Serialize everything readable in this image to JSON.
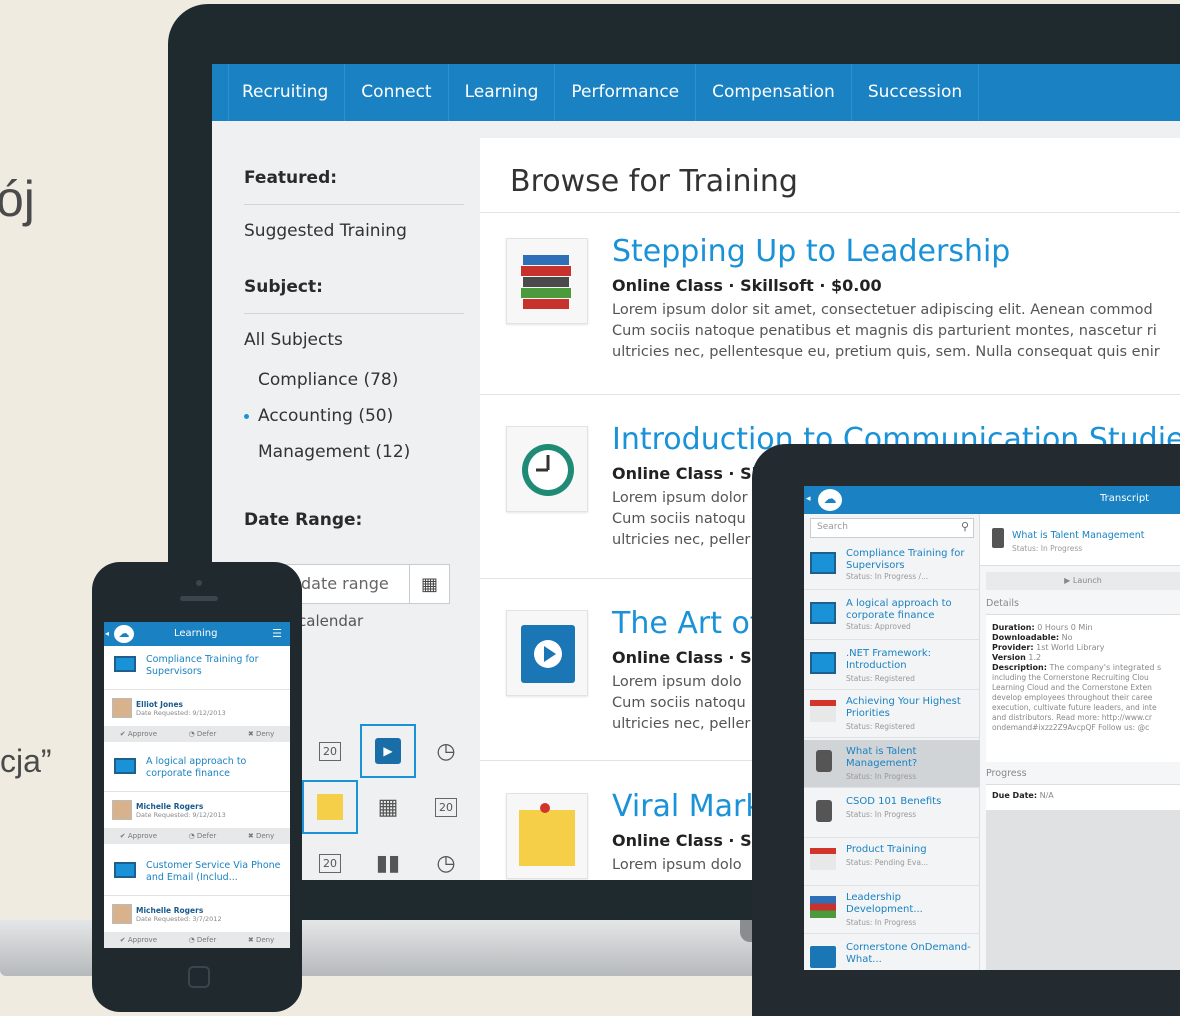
{
  "background": {
    "fragment_1": "ój",
    "fragment_2": "cja”"
  },
  "laptop": {
    "nav": [
      "Recruiting",
      "Connect",
      "Learning",
      "Performance",
      "Compensation",
      "Succession"
    ],
    "sidebar": {
      "featured_heading": "Featured:",
      "suggested": "Suggested Training",
      "subject_heading": "Subject:",
      "all_subjects": "All Subjects",
      "subjects": [
        {
          "label": "Compliance (78)",
          "selected": false
        },
        {
          "label": "Accounting (50)",
          "selected": true
        },
        {
          "label": "Management (12)",
          "selected": false
        }
      ],
      "date_range_heading": "Date Range:",
      "date_placeholder": "date range",
      "calendar_label": "calendar",
      "grid_day": "20"
    },
    "main": {
      "title": "Browse for Training",
      "courses": [
        {
          "title": "Stepping Up to Leadership",
          "meta": "Online Class · Skillsoft · $0.00",
          "desc": [
            "Lorem ipsum dolor sit amet, consectetuer adipiscing elit. Aenean commod",
            "Cum sociis natoque penatibus et magnis dis parturient montes, nascetur ri",
            "ultricies nec, pellentesque eu, pretium quis, sem. Nulla consequat quis enir"
          ]
        },
        {
          "title": "Introduction to Communication Studies",
          "meta": "Online Class · Sk",
          "desc": [
            "Lorem ipsum dolor",
            "Cum sociis natoqu",
            "ultricies nec, peller"
          ]
        },
        {
          "title": "The Art of",
          "meta": "Online Class · Sk",
          "desc": [
            "Lorem ipsum dolo",
            "Cum sociis natoqu",
            "ultricies nec, peller"
          ]
        },
        {
          "title": "Viral Mark",
          "meta": "Online Class · Sk",
          "desc": [
            "Lorem ipsum dolo"
          ]
        }
      ]
    }
  },
  "tablet": {
    "header_title": "Transcript",
    "search_placeholder": "Search",
    "items": [
      {
        "title": "Compliance Training for Supervisors",
        "status": "Status: In Progress /..."
      },
      {
        "title": "A logical approach to corporate finance",
        "status": "Status: Approved"
      },
      {
        "title": ".NET Framework: Introduction",
        "status": "Status: Registered"
      },
      {
        "title": "Achieving Your Highest Priorities",
        "status": "Status: Registered"
      },
      {
        "title": "What is Talent Management?",
        "status": "Status: In Progress"
      },
      {
        "title": "CSOD 101 Benefits",
        "status": "Status: In Progress"
      },
      {
        "title": "Product Training",
        "status": "Status: Pending Eva..."
      },
      {
        "title": "Leadership Development...",
        "status": "Status: In Progress"
      },
      {
        "title": "Cornerstone OnDemand-What...",
        "status": ""
      }
    ],
    "detail": {
      "title": "What is Talent Management",
      "status": "Status: In Progress",
      "launch": "Launch",
      "details_heading": "Details",
      "duration_label": "Duration:",
      "duration": "0 Hours 0 Min",
      "downloadable_label": "Downloadable:",
      "downloadable": "No",
      "provider_label": "Provider:",
      "provider": "1st World Library",
      "version_label": "Version",
      "version": "1.2",
      "description_label": "Description:",
      "description": [
        "The company's integrated s",
        "including the Cornerstone Recruiting Clou",
        "Learning Cloud and the Cornerstone Exten",
        "develop employees throughout their caree",
        "execution, cultivate future leaders, and inte",
        "and distributors. Read more: http://www.cr",
        "ondemand#ixzz2Z9AvcpQF Follow us: @c"
      ],
      "progress_heading": "Progress",
      "due_date_label": "Due Date:",
      "due_date": "N/A"
    }
  },
  "phone": {
    "header_title": "Learning",
    "requests": [
      {
        "course": "Compliance Training for Supervisors",
        "person": "Elliot Jones",
        "date": "Date Requested: 9/12/2013"
      },
      {
        "course": "A logical approach to corporate finance",
        "person": "Michelle Rogers",
        "date": "Date Requested: 9/12/2013"
      },
      {
        "course": "Customer Service Via Phone and Email (Includ...",
        "person": "Michelle Rogers",
        "date": "Date Requested: 3/7/2012"
      }
    ],
    "actions": {
      "approve": "Approve",
      "defer": "Defer",
      "deny": "Deny"
    }
  }
}
